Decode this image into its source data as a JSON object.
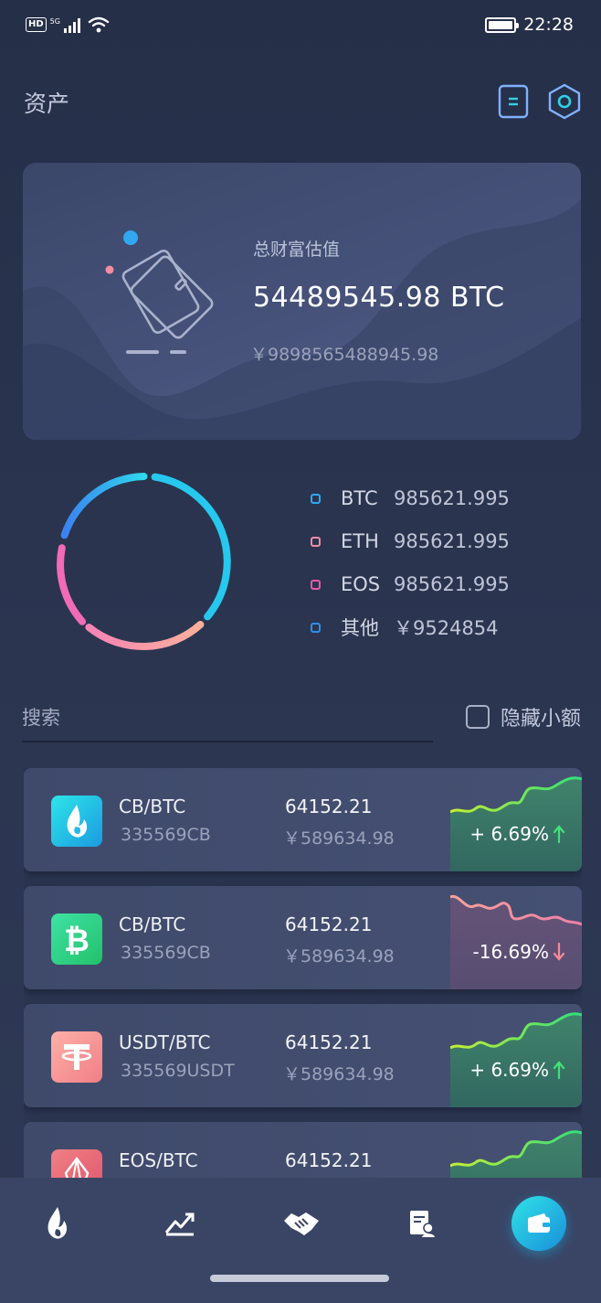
{
  "status_bar": {
    "network_badge": "HD",
    "network_type": "5G",
    "time": "22:28"
  },
  "header": {
    "title": "资产"
  },
  "wealth": {
    "label": "总财富估值",
    "btc_value": "54489545.98 BTC",
    "cny_value": "￥9898565488945.98"
  },
  "allocation": {
    "legend": [
      {
        "name": "BTC",
        "value": "985621.995",
        "color": "#2fa8f0"
      },
      {
        "name": "ETH",
        "value": "985621.995",
        "color": "#f08ea4"
      },
      {
        "name": "EOS",
        "value": "985621.995",
        "color": "#e65aa8"
      },
      {
        "name": "其他",
        "value": "￥9524854",
        "color": "#2f8ef0"
      }
    ]
  },
  "search": {
    "placeholder": "搜索",
    "hide_small_label": "隐藏小额"
  },
  "coins": [
    {
      "pair": "CB/BTC",
      "amount": "335569CB",
      "price": "64152.21",
      "cny": "￥589634.98",
      "change": "+ 6.69%",
      "direction": "up",
      "icon": "flame-icon"
    },
    {
      "pair": "CB/BTC",
      "amount": "335569CB",
      "price": "64152.21",
      "cny": "￥589634.98",
      "change": "-16.69%",
      "direction": "down",
      "icon": "bitcoin-icon"
    },
    {
      "pair": "USDT/BTC",
      "amount": "335569USDT",
      "price": "64152.21",
      "cny": "￥589634.98",
      "change": "+ 6.69%",
      "direction": "up",
      "icon": "tether-icon"
    },
    {
      "pair": "EOS/BTC",
      "amount": "",
      "price": "64152.21",
      "cny": "",
      "change": "",
      "direction": "up",
      "icon": "eos-icon"
    }
  ],
  "colors": {
    "up": "#44e07a",
    "down": "#f58a98",
    "accent": "#2fe3e6"
  }
}
